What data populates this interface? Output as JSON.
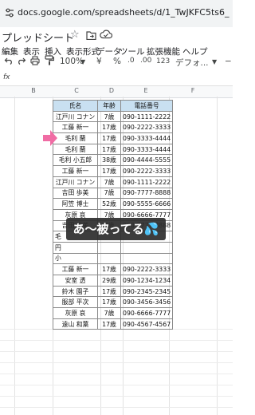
{
  "browser": {
    "url": "docs.google.com/spreadsheets/d/1_TwJKFC5ts6_ufa8nUVKBCvWEZOavAMnfVFz"
  },
  "doc": {
    "title": "プレッドシート",
    "star_glyph": "☆"
  },
  "menu": {
    "items": [
      "編集",
      "表示",
      "挿入",
      "表示形式",
      "データ",
      "ツール",
      "拡張機能",
      "ヘルプ"
    ]
  },
  "toolbar": {
    "zoom": "100%",
    "currency": "¥",
    "percent": "%",
    "dec_decrease": ".0",
    "dec_increase": ".00",
    "number_format": "123",
    "font": "デフォ...",
    "minus": "−"
  },
  "formula": {
    "fx": "fx"
  },
  "sheet": {
    "columns": [
      "B",
      "C",
      "D",
      "E",
      "F"
    ],
    "headers": [
      "氏名",
      "年齢",
      "電話番号"
    ],
    "rows": [
      [
        "江戸川 コナン",
        "7歳",
        "090-1111-2222"
      ],
      [
        "工藤 新一",
        "17歳",
        "090-2222-3333"
      ],
      [
        "毛利 蘭",
        "17歳",
        "090-3333-4444"
      ],
      [
        "毛利 蘭",
        "17歳",
        "090-3333-4444"
      ],
      [
        "毛利 小五郎",
        "38歳",
        "090-4444-5555"
      ],
      [
        "工藤 新一",
        "17歳",
        "090-2222-3333"
      ],
      [
        "江戸川 コナン",
        "7歳",
        "090-1111-2222"
      ],
      [
        "吉田 歩美",
        "7歳",
        "090-7777-8888"
      ],
      [
        "阿笠 博士",
        "52歳",
        "090-5555-6666"
      ],
      [
        "灰原 哀",
        "7歳",
        "090-6666-7777"
      ],
      [
        "吉田 歩美",
        "7歳",
        "090-7777-8888"
      ],
      [
        "毛",
        "",
        ""
      ],
      [
        "円",
        "",
        ""
      ],
      [
        "小",
        "",
        ""
      ],
      [
        "工藤 新一",
        "17歳",
        "090-2222-3333"
      ],
      [
        "安室 透",
        "29歳",
        "090-1234-1234"
      ],
      [
        "鈴木 園子",
        "17歳",
        "090-2345-2345"
      ],
      [
        "服部 平次",
        "17歳",
        "090-3456-3456"
      ],
      [
        "灰原 哀",
        "7歳",
        "090-6666-7777"
      ],
      [
        "遠山 和葉",
        "17歳",
        "090-4567-4567"
      ]
    ]
  },
  "caption": {
    "text": "あ〜被ってる💦"
  },
  "colors": {
    "header_fill": "#c9e0f1",
    "arrow": "#f06ca4",
    "caption_bg": "#2d2d2d"
  }
}
